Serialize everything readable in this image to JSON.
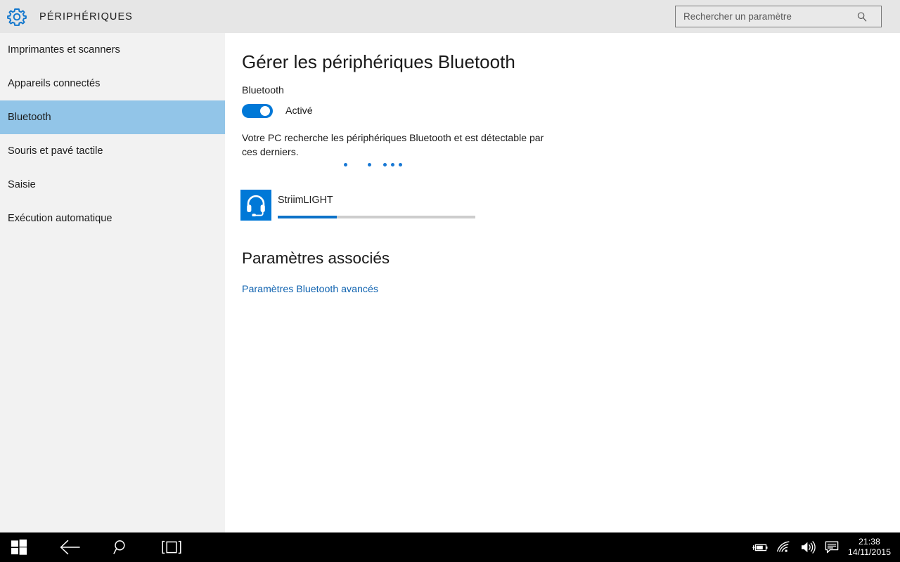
{
  "window": {
    "app_title": "PÉRIPHÉRIQUES",
    "gear_icon": "gear-icon",
    "accent_color": "#0078d7",
    "sidebar_bg": "#f2f2f2",
    "header_bg": "#e6e6e6",
    "selection_color": "#92c5e8"
  },
  "search": {
    "placeholder": "Rechercher un paramètre",
    "value": "",
    "icon": "search-icon"
  },
  "sidebar": {
    "items": [
      {
        "label": "Imprimantes et scanners",
        "selected": false
      },
      {
        "label": "Appareils connectés",
        "selected": false
      },
      {
        "label": "Bluetooth",
        "selected": true
      },
      {
        "label": "Souris et pavé tactile",
        "selected": false
      },
      {
        "label": "Saisie",
        "selected": false
      },
      {
        "label": "Exécution automatique",
        "selected": false
      }
    ]
  },
  "main": {
    "page_title": "Gérer les périphériques Bluetooth",
    "bluetooth_label": "Bluetooth",
    "toggle": {
      "state_label": "Activé",
      "on": true
    },
    "status_text": "Votre PC recherche les périphériques Bluetooth et est détectable par ces derniers.",
    "searching_dots": 5,
    "devices": [
      {
        "name": "StriimLIGHT",
        "icon": "headset-icon",
        "progress_percent": 30
      }
    ],
    "related": {
      "title": "Paramètres associés",
      "links": [
        {
          "label": "Paramètres Bluetooth avancés"
        }
      ]
    }
  },
  "taskbar": {
    "buttons": [
      {
        "name": "start-button",
        "icon": "windows-logo-icon"
      },
      {
        "name": "back-button",
        "icon": "back-arrow-icon"
      },
      {
        "name": "search-button",
        "icon": "search-icon"
      },
      {
        "name": "task-view-button",
        "icon": "task-view-icon"
      }
    ],
    "tray": [
      {
        "name": "battery-tray-icon",
        "icon": "battery-charging-icon"
      },
      {
        "name": "network-tray-icon",
        "icon": "wifi-icon"
      },
      {
        "name": "volume-tray-icon",
        "icon": "speaker-icon"
      },
      {
        "name": "action-center-icon",
        "icon": "notification-icon"
      }
    ],
    "clock": {
      "time": "21:38",
      "date": "14/11/2015"
    }
  }
}
